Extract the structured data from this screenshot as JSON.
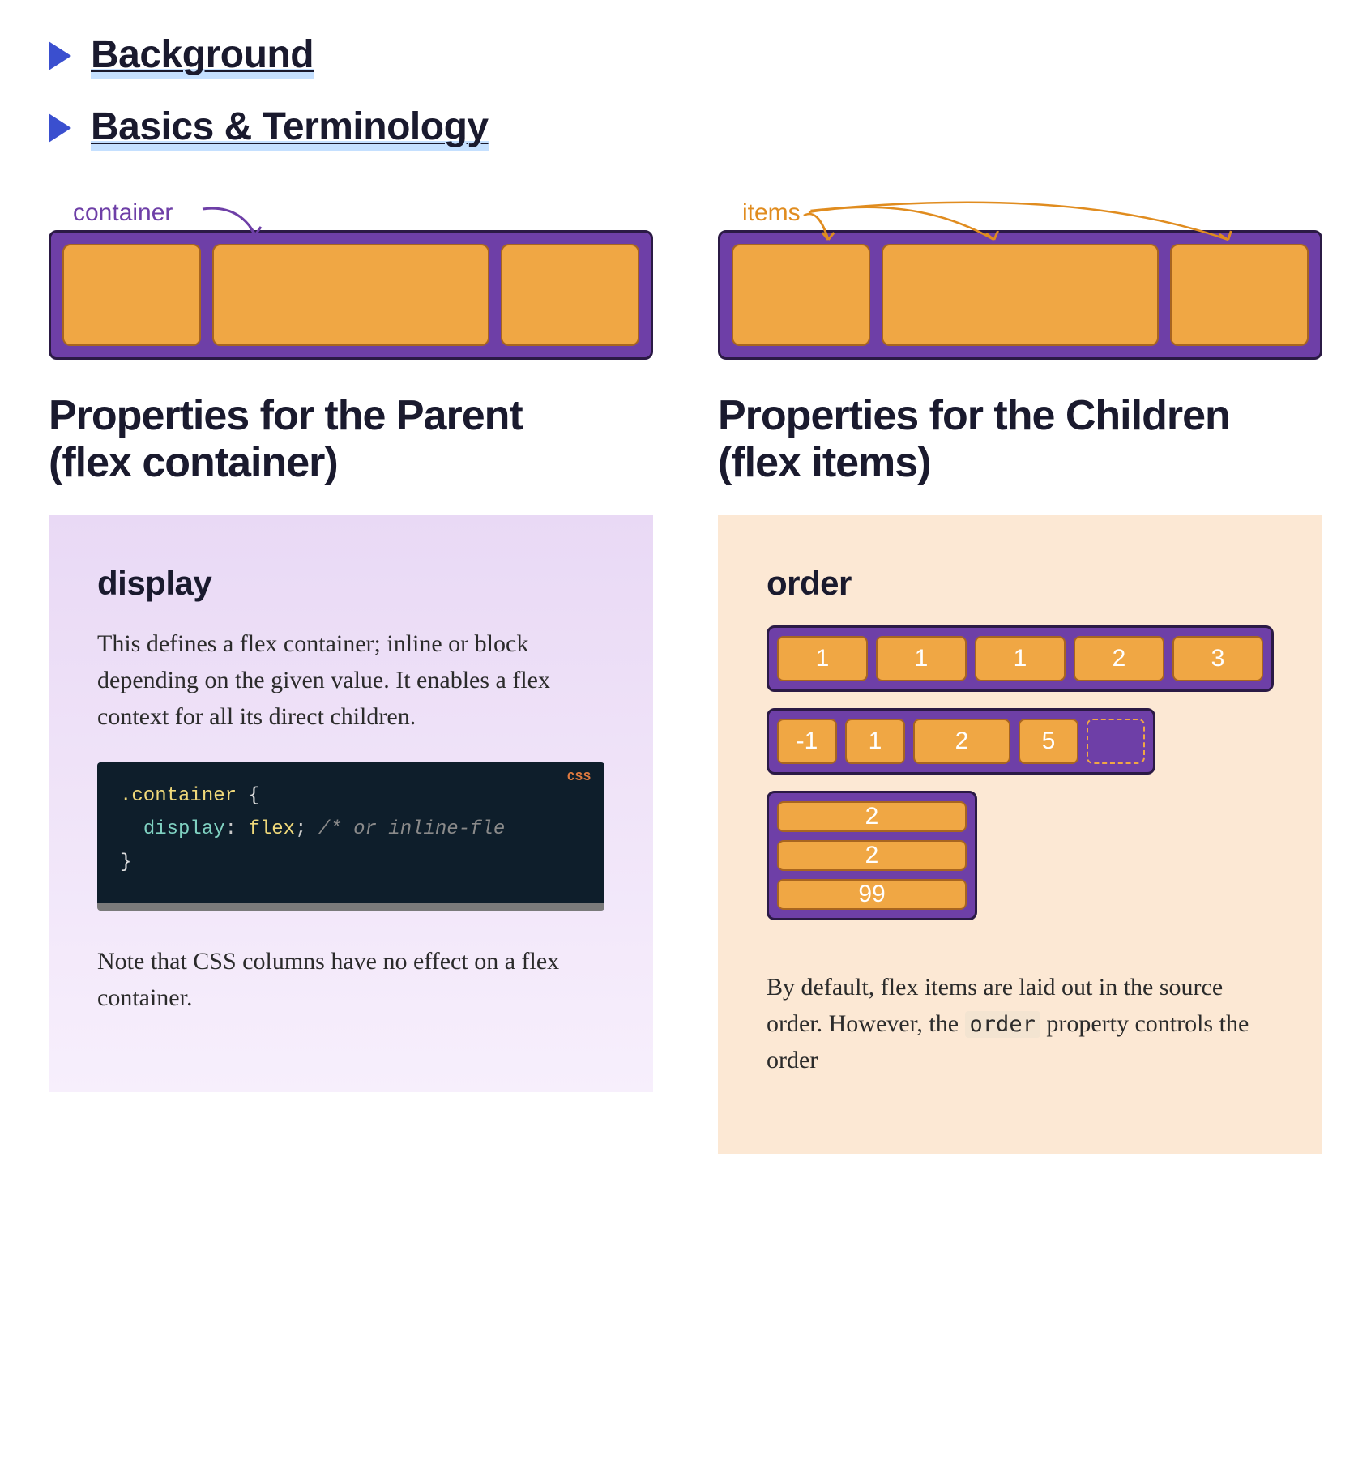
{
  "accordion": [
    {
      "title": "Background"
    },
    {
      "title": "Basics & Terminology"
    }
  ],
  "columns": {
    "parent": {
      "illo_label": "container",
      "heading": "Properties for the Parent\n(flex container)",
      "display_section": {
        "title": "display",
        "desc": "This defines a flex container; inline or block depending on the given value. It enables a flex context for all its direct children.",
        "code": {
          "lang": "CSS",
          "selector": ".container",
          "property": "display",
          "value": "flex",
          "comment": "/* or inline-fle"
        },
        "note": "Note that CSS columns have no effect on a flex container."
      }
    },
    "children": {
      "illo_label": "items",
      "heading": "Properties for the Children\n(flex items)",
      "order_section": {
        "title": "order",
        "rows": {
          "row1": [
            "1",
            "1",
            "1",
            "2",
            "3"
          ],
          "row2": [
            "-1",
            "1",
            "2",
            "5"
          ],
          "row3": [
            "2",
            "2",
            "99"
          ]
        },
        "desc_start": "By default, flex items are laid out in the source order. However, the ",
        "desc_code": "order",
        "desc_end": " property controls the order"
      }
    }
  }
}
